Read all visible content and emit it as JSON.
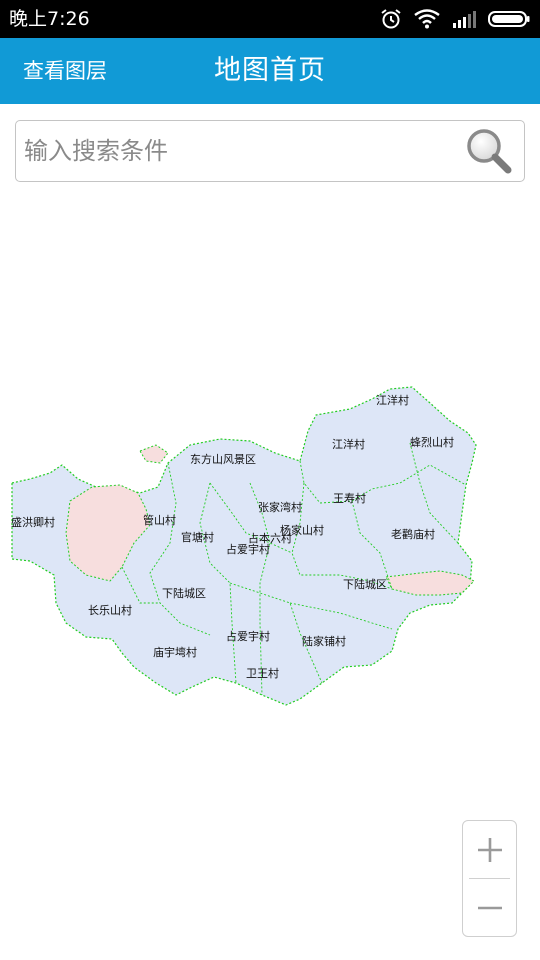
{
  "status_bar": {
    "time": "晚上7:26",
    "icons": [
      "alarm-icon",
      "wifi-icon",
      "signal-icon",
      "battery-icon"
    ]
  },
  "header": {
    "layers_button": "查看图层",
    "title": "地图首页",
    "background_color": "#119ad6"
  },
  "search": {
    "placeholder": "输入搜索条件",
    "icon": "search-icon"
  },
  "map": {
    "region_color": "#dde6f7",
    "highlight_color": "#f7dede",
    "boundary_color": "#22cc22",
    "labels": [
      {
        "text": "江洋村"
      },
      {
        "text": "江洋村"
      },
      {
        "text": "蜂烈山村"
      },
      {
        "text": "东方山风景区"
      },
      {
        "text": "王寿村"
      },
      {
        "text": "张家湾村"
      },
      {
        "text": "盛洪卿村"
      },
      {
        "text": "管山村"
      },
      {
        "text": "杨家山村"
      },
      {
        "text": "老鹳庙村"
      },
      {
        "text": "官塘村"
      },
      {
        "text": "占本六村"
      },
      {
        "text": "占爱宇村"
      },
      {
        "text": "下陆城区"
      },
      {
        "text": "下陆城区"
      },
      {
        "text": "长乐山村"
      },
      {
        "text": "占爱宇村"
      },
      {
        "text": "陆家铺村"
      },
      {
        "text": "庙宇塆村"
      },
      {
        "text": "卫王村"
      }
    ]
  },
  "zoom": {
    "zoom_in": "+",
    "zoom_out": "−"
  }
}
